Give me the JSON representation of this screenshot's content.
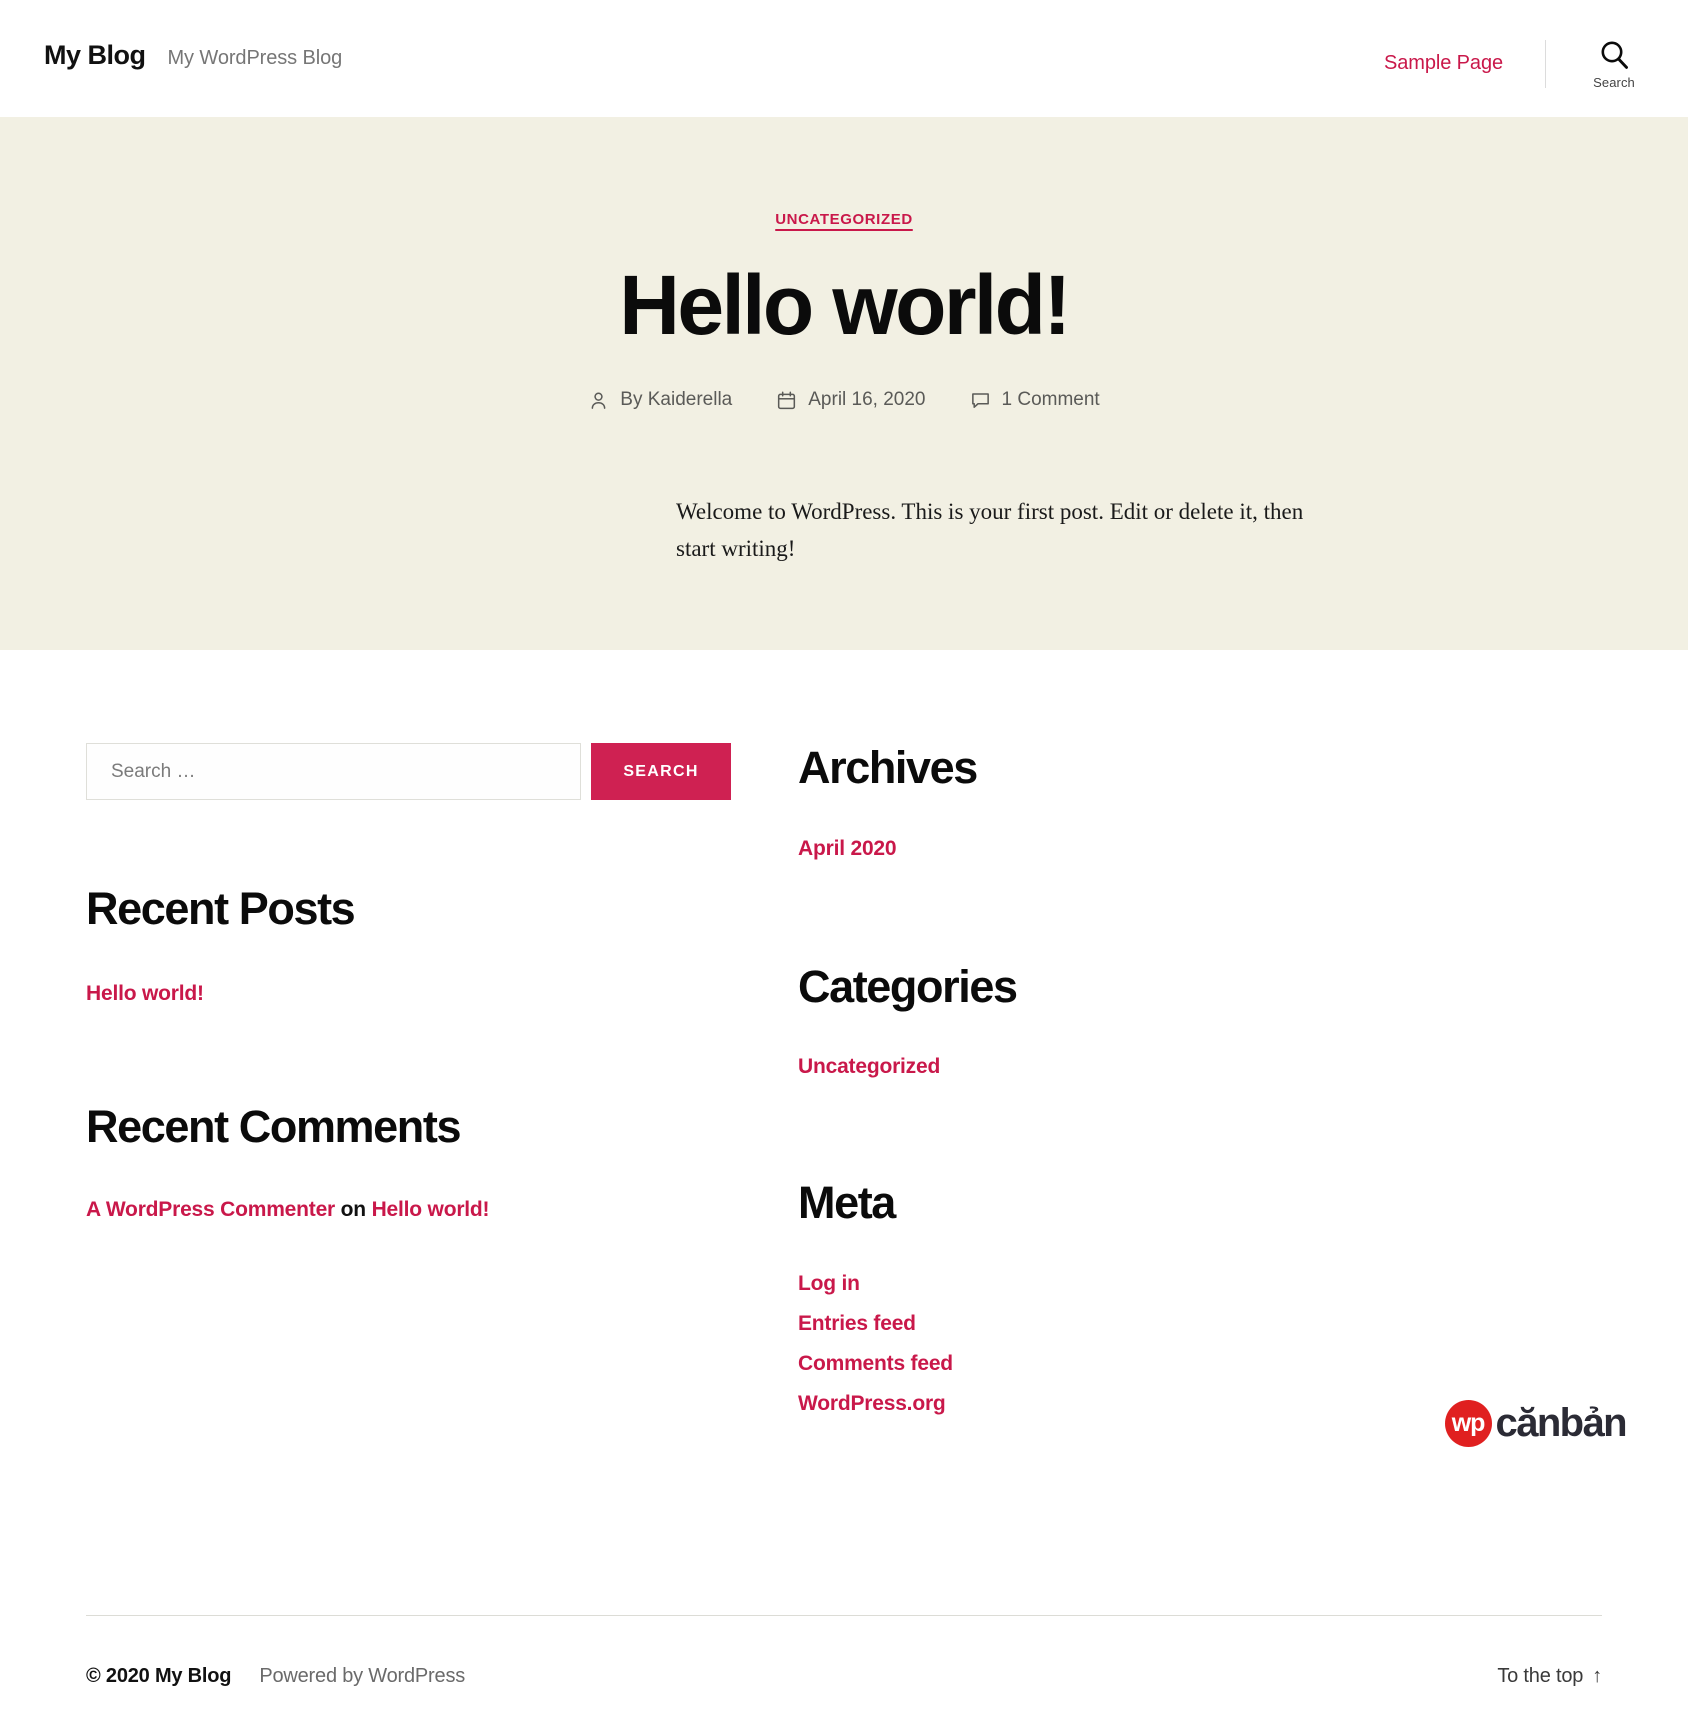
{
  "theme": {
    "accent": "#c9184a",
    "button_bg": "#cf2152",
    "hero_bg": "#f2f0e3",
    "body_bg": "#ffffff",
    "text": "#111111",
    "muted": "#767676"
  },
  "header": {
    "site_title": "My Blog",
    "tagline": "My WordPress Blog",
    "nav": [
      {
        "label": "Sample Page"
      }
    ],
    "search_toggle_label": "Search",
    "search_icon": "search-icon"
  },
  "post": {
    "category": "UNCATEGORIZED",
    "title": "Hello world!",
    "meta": {
      "author_icon": "person-icon",
      "author": "By Kaiderella",
      "date_icon": "calendar-icon",
      "date": "April 16, 2020",
      "comments_icon": "comment-bubble-icon",
      "comments": "1 Comment"
    },
    "body": "Welcome to WordPress. This is your first post. Edit or delete it, then start writing!"
  },
  "search_widget": {
    "placeholder": "Search …",
    "value": "",
    "submit_label": "SEARCH"
  },
  "widgets_left": [
    {
      "title": "Recent Posts",
      "items": [
        {
          "label": "Hello world!"
        }
      ]
    },
    {
      "title": "Recent Comments",
      "comment": {
        "author": "A WordPress Commenter",
        "connector": "on",
        "post": "Hello world!"
      }
    }
  ],
  "widgets_right": [
    {
      "title": "Archives",
      "items": [
        {
          "label": "April 2020"
        }
      ]
    },
    {
      "title": "Categories",
      "items": [
        {
          "label": "Uncategorized"
        }
      ]
    },
    {
      "title": "Meta",
      "items": [
        {
          "label": "Log in"
        },
        {
          "label": "Entries feed"
        },
        {
          "label": "Comments feed"
        },
        {
          "label": "WordPress.org"
        }
      ]
    }
  ],
  "watermark": {
    "badge": "wp",
    "text": "cănbản",
    "badge_color": "#e02020"
  },
  "footer": {
    "copyright": "© 2020 My Blog",
    "powered_by": "Powered by WordPress",
    "to_top": "To the top",
    "to_top_arrow": "↑"
  }
}
